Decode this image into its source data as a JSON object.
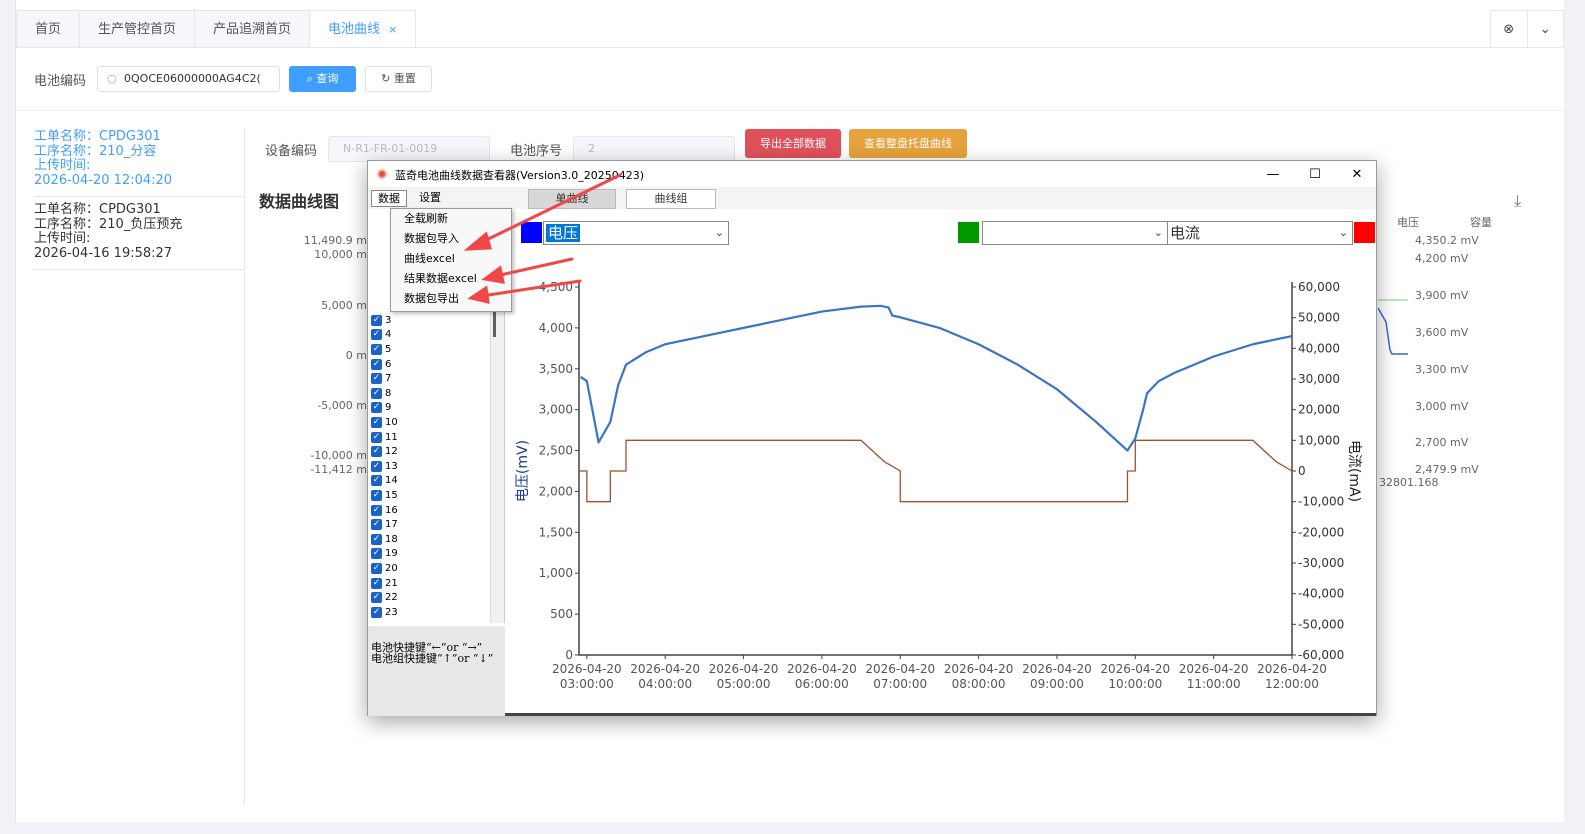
{
  "tabs": [
    {
      "label": "首页",
      "active": false
    },
    {
      "label": "生产管控首页",
      "active": false
    },
    {
      "label": "产品追溯首页",
      "active": false
    },
    {
      "label": "电池曲线",
      "active": true
    }
  ],
  "tab_close_glyph": "×",
  "search": {
    "label": "电池编码",
    "value": "0QOCE06000000AG4C2(",
    "query_label": "查询",
    "reset_label": "重置"
  },
  "records": [
    {
      "order": "工单名称：CPDG301",
      "process": "工序名称：210_分容",
      "upload_label": "上传时间:",
      "upload_time": "2026-04-20 12:04:20"
    },
    {
      "order": "工单名称：CPDG301",
      "process": "工序名称：210_负压预充",
      "upload_label": "上传时间:",
      "upload_time": "2026-04-16 19:58:27"
    }
  ],
  "device": {
    "code_label": "设备编码",
    "code_value": "N-R1-FR-01-0019",
    "seq_label": "电池序号",
    "seq_value": "2",
    "export_all": "导出全部数据",
    "view_tray": "查看整盘托盘曲线"
  },
  "chart_section_title": "数据曲线图",
  "bg_left_axis": [
    "11,490.9 m",
    "10,000 m",
    "5,000 m",
    "0 m",
    "-5,000 m",
    "-10,000 m",
    "-11,412 m"
  ],
  "bg_right_headers": [
    "电压",
    "容量"
  ],
  "bg_right_axis": [
    "4,350.2 mV",
    "4,200 mV",
    "3,900 mV",
    "3,600 mV",
    "3,300 mV",
    "3,000 mV",
    "2,700 mV",
    "2,479.9 mV"
  ],
  "bg_extra_value": "32801.168",
  "dialog": {
    "title": "蓝奇电池曲线数据查看器(Version3.0_20250423)",
    "menus": [
      "数据",
      "设置"
    ],
    "subtabs": [
      "单曲线",
      "曲线组"
    ],
    "dropdown": [
      "全载刷新",
      "数据包导入",
      "曲线excel",
      "结果数据excel",
      "数据包导出"
    ],
    "left_select": "电压",
    "right_select": "电流",
    "swatch_colors": {
      "left": "#0000ff",
      "mid": "#009900",
      "right": "#ff0000"
    },
    "list_items": [
      "3",
      "4",
      "5",
      "6",
      "7",
      "8",
      "9",
      "10",
      "11",
      "12",
      "13",
      "14",
      "15",
      "16",
      "17",
      "18",
      "19",
      "20",
      "21",
      "22",
      "23"
    ],
    "hint_lines": [
      "电池快捷键“←”or “→”",
      "电池组快捷键“↑”or “↓”"
    ]
  },
  "chart_data": {
    "type": "line",
    "ylabel": "电压(mV)",
    "y2label": "电流(mA)",
    "ylim": [
      0,
      4500
    ],
    "y2lim": [
      -60000,
      60000
    ],
    "yticks": [
      0,
      500,
      1000,
      1500,
      2000,
      2500,
      3000,
      3500,
      4000,
      4500
    ],
    "yticklabels": [
      "0",
      "500",
      "1,000",
      "1,500",
      "2,000",
      "2,500",
      "3,000",
      "3,500",
      "4,000",
      "4,500"
    ],
    "y2ticks": [
      -60000,
      -50000,
      -40000,
      -30000,
      -20000,
      -10000,
      0,
      10000,
      20000,
      30000,
      40000,
      50000,
      60000
    ],
    "y2ticklabels": [
      "-60,000",
      "-50,000",
      "-40,000",
      "-30,000",
      "-20,000",
      "-10,000",
      "0",
      "10,000",
      "20,000",
      "30,000",
      "40,000",
      "50,000",
      "60,000"
    ],
    "x_dates": [
      "2026-04-20",
      "2026-04-20",
      "2026-04-20",
      "2026-04-20",
      "2026-04-20",
      "2026-04-20",
      "2026-04-20",
      "2026-04-20",
      "2026-04-20",
      "2026-04-20"
    ],
    "x_times": [
      "03:00:00",
      "04:00:00",
      "05:00:00",
      "06:00:00",
      "07:00:00",
      "08:00:00",
      "09:00:00",
      "10:00:00",
      "11:00:00",
      "12:00:00"
    ],
    "xlim_hours": [
      2.9,
      12.0
    ],
    "voltage": {
      "hours": [
        2.92,
        3.0,
        3.15,
        3.3,
        3.4,
        3.5,
        3.75,
        4.0,
        4.5,
        5.0,
        5.5,
        6.0,
        6.5,
        6.75,
        6.85,
        6.9,
        7.0,
        7.5,
        8.0,
        8.5,
        9.0,
        9.5,
        9.9,
        10.0,
        10.1,
        10.15,
        10.3,
        10.5,
        11.0,
        11.5,
        12.0
      ],
      "values": [
        3400,
        3350,
        2600,
        2850,
        3300,
        3550,
        3700,
        3800,
        3900,
        4000,
        4100,
        4200,
        4260,
        4270,
        4250,
        4150,
        4130,
        4000,
        3800,
        3550,
        3250,
        2850,
        2500,
        2650,
        3000,
        3200,
        3350,
        3450,
        3650,
        3800,
        3900
      ]
    },
    "current": {
      "hours": [
        2.9,
        3.0,
        3.0,
        3.3,
        3.3,
        3.5,
        3.5,
        6.5,
        6.8,
        7.0,
        7.0,
        9.9,
        9.9,
        10.0,
        10.0,
        11.5,
        11.8,
        12.0
      ],
      "values": [
        0,
        0,
        -10000,
        -10000,
        0,
        0,
        10000,
        10000,
        3000,
        0,
        -10000,
        -10000,
        0,
        0,
        10000,
        10000,
        3000,
        0
      ]
    }
  }
}
